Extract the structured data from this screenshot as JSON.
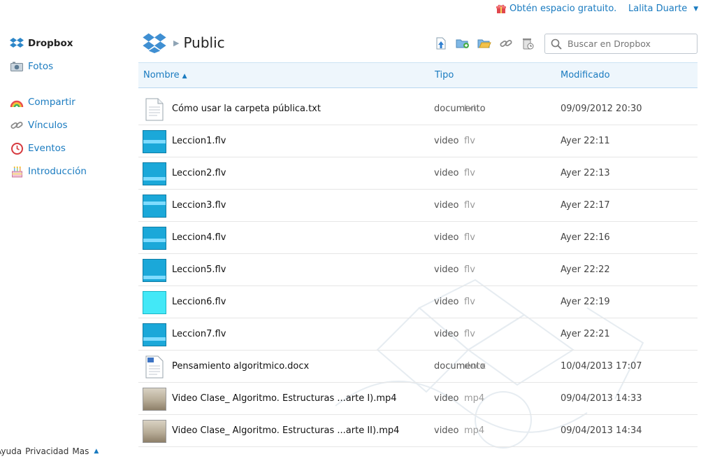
{
  "topbar": {
    "free_space": "Obtén espacio gratuito.",
    "user_name": "Lalita Duarte"
  },
  "sidebar": {
    "items": [
      {
        "label": "Dropbox",
        "icon": "dropbox-logo-icon"
      },
      {
        "label": "Fotos",
        "icon": "camera-icon"
      },
      {
        "label": "Compartir",
        "icon": "rainbow-icon"
      },
      {
        "label": "Vínculos",
        "icon": "link-icon"
      },
      {
        "label": "Eventos",
        "icon": "clock-icon"
      },
      {
        "label": "Introducción",
        "icon": "cake-icon"
      }
    ]
  },
  "footer": {
    "links": [
      "Ayuda",
      "Privacidad",
      "Mas"
    ]
  },
  "header": {
    "folder": "Public"
  },
  "toolbar": {
    "icons": [
      "upload-icon",
      "new-folder-icon",
      "share-folder-icon",
      "get-link-icon",
      "deleted-files-icon"
    ]
  },
  "search": {
    "placeholder": "Buscar en Dropbox"
  },
  "table": {
    "columns": {
      "name": "Nombre",
      "type": "Tipo",
      "modified": "Modificado"
    },
    "rows": [
      {
        "name": "Cómo usar la carpeta pública.txt",
        "kind": "documento",
        "ext": "txt",
        "modified": "09/09/2012 20:30",
        "thumb": "doc"
      },
      {
        "name": "Leccion1.flv",
        "kind": "video",
        "ext": "flv",
        "modified": "Ayer 22:11",
        "thumb": "video"
      },
      {
        "name": "Leccion2.flv",
        "kind": "video",
        "ext": "flv",
        "modified": "Ayer 22:13",
        "thumb": "video"
      },
      {
        "name": "Leccion3.flv",
        "kind": "video",
        "ext": "flv",
        "modified": "Ayer 22:17",
        "thumb": "video"
      },
      {
        "name": "Leccion4.flv",
        "kind": "video",
        "ext": "flv",
        "modified": "Ayer 22:16",
        "thumb": "video"
      },
      {
        "name": "Leccion5.flv",
        "kind": "video",
        "ext": "flv",
        "modified": "Ayer 22:22",
        "thumb": "video"
      },
      {
        "name": "Leccion6.flv",
        "kind": "video",
        "ext": "flv",
        "modified": "Ayer 22:19",
        "thumb": "cyan"
      },
      {
        "name": "Leccion7.flv",
        "kind": "video",
        "ext": "flv",
        "modified": "Ayer 22:21",
        "thumb": "video"
      },
      {
        "name": "Pensamiento algoritmico.docx",
        "kind": "documento",
        "ext": "docx",
        "modified": "10/04/2013 17:07",
        "thumb": "doc"
      },
      {
        "name": "Video Clase_ Algoritmo. Estructuras ...arte I).mp4",
        "kind": "video",
        "ext": "mp4",
        "modified": "09/04/2013 14:33",
        "thumb": "photo"
      },
      {
        "name": "Video Clase_ Algoritmo. Estructuras ...arte II).mp4",
        "kind": "video",
        "ext": "mp4",
        "modified": "09/04/2013 14:34",
        "thumb": "photo"
      }
    ]
  },
  "colors": {
    "link": "#1a7bc0",
    "header_bg": "#eef6fc",
    "video_thumb": "#1ba8d9"
  }
}
